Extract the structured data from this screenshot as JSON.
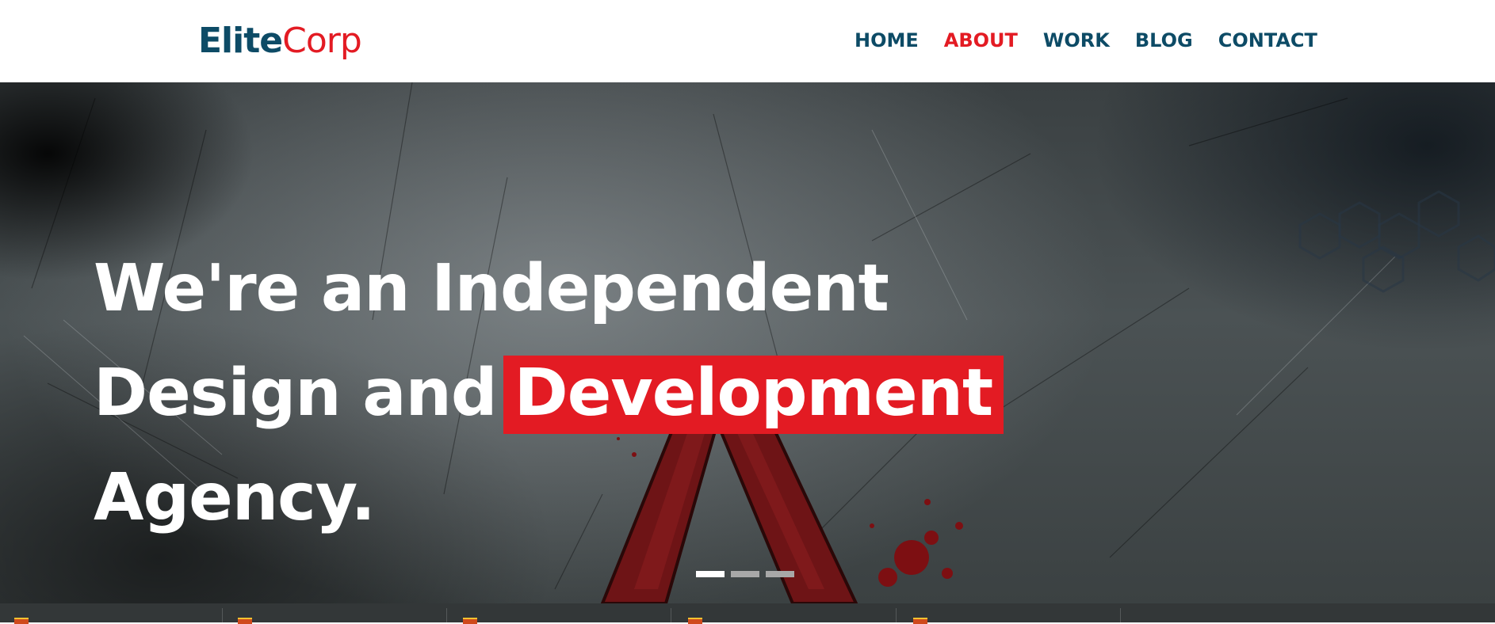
{
  "header": {
    "logo": {
      "part1": "Elite",
      "part2": "Corp"
    },
    "nav": [
      {
        "label": "HOME",
        "active": false
      },
      {
        "label": "ABOUT",
        "active": true
      },
      {
        "label": "WORK",
        "active": false
      },
      {
        "label": "BLOG",
        "active": false
      },
      {
        "label": "CONTACT",
        "active": false
      }
    ]
  },
  "hero": {
    "line1": "We're an Independent",
    "line2_prefix": "Design and",
    "line2_highlight": "Development",
    "line3": "Agency.",
    "slides": {
      "count": 3,
      "active_index": 0
    }
  },
  "colors": {
    "brand_dark": "#0d4b66",
    "brand_red": "#e31b23",
    "hero_bg": "#4b5254",
    "strip_bg": "#333738"
  },
  "icons": [
    "slider-dot",
    "assassin-emblem",
    "hexagon-pattern"
  ]
}
